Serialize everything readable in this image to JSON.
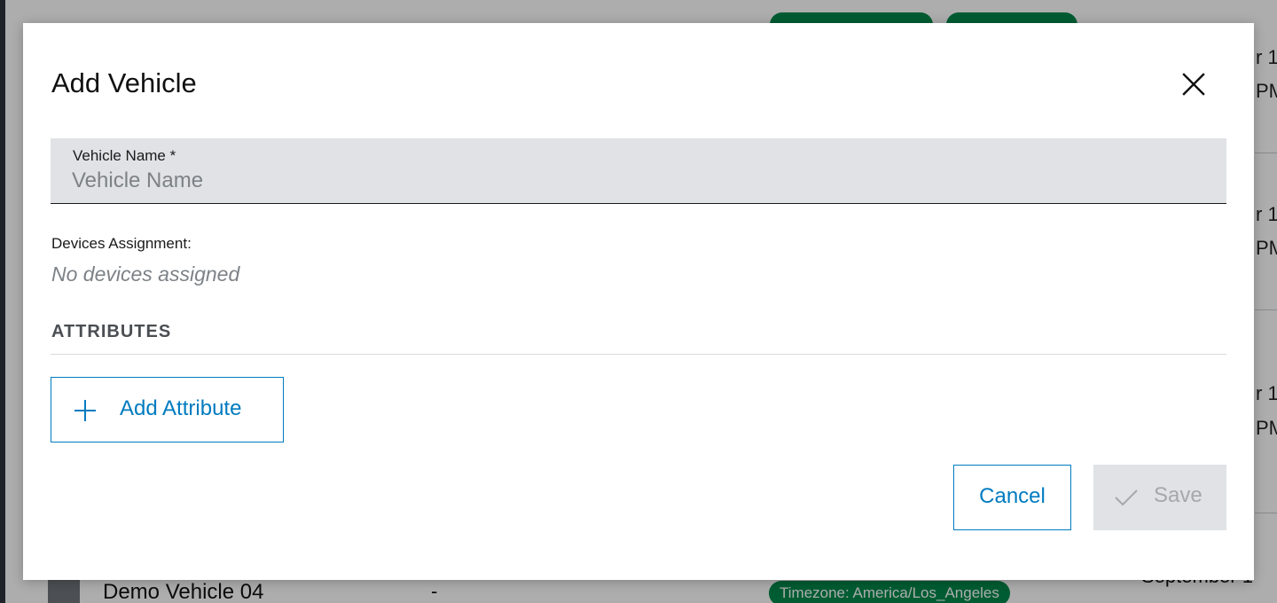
{
  "background": {
    "dates": [
      "r 1",
      "PM",
      "r 1",
      "PM",
      "r 1",
      "PM"
    ],
    "pills_top": [
      "",
      ""
    ],
    "row": {
      "name": "Demo Vehicle 04",
      "dash": "-",
      "timezone": "Timezone: America/Los_Angeles",
      "date": "September 1"
    }
  },
  "dialog": {
    "title": "Add Vehicle",
    "close_icon": "close-icon",
    "vehicle_name": {
      "label": "Vehicle Name *",
      "placeholder": "Vehicle Name",
      "value": ""
    },
    "devices": {
      "label": "Devices Assignment:",
      "value": "No devices assigned"
    },
    "attributes": {
      "heading": "ATTRIBUTES",
      "add_button_label": "Add Attribute",
      "add_icon": "plus-icon"
    },
    "footer": {
      "cancel_label": "Cancel",
      "save_label": "Save",
      "save_icon": "check-icon",
      "save_enabled": false
    }
  },
  "colors": {
    "accent": "#007bc0",
    "field_bg": "#e0e2e5",
    "placeholder": "#7d8287",
    "pill_green": "#00884a",
    "disabled_text": "#a4a8ac"
  }
}
